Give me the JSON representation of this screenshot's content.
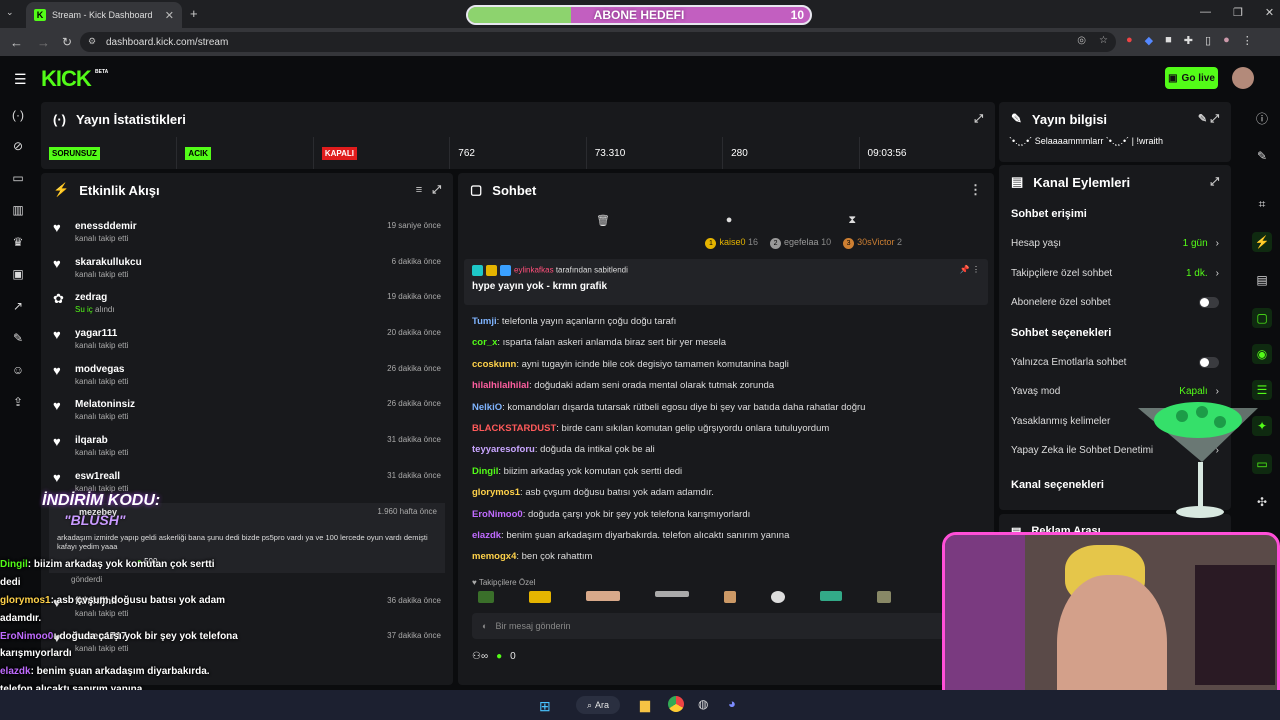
{
  "browser": {
    "tab_title": "Stream - Kick Dashboard",
    "url": "dashboard.kick.com/stream",
    "new_tab": "+"
  },
  "goal": {
    "label": "ABONE HEDEFI",
    "count": "10",
    "progress": 0.3
  },
  "header": {
    "logo": "KICK",
    "logo_sup": "BETA",
    "go_live": "Go live"
  },
  "stats": {
    "title": "Yayın İstatistikleri",
    "status1": "SORUNSUZ",
    "status2": "ACIK",
    "status3": "KAPALI",
    "viewers": "762",
    "followers": "73.310",
    "subs": "280",
    "duration": "09:03:56"
  },
  "activity": {
    "title": "Etkinlik Akışı",
    "events": [
      {
        "icon": "heart-icon",
        "name": "enessddemir",
        "sub": "kanalı takip etti",
        "time": "19 saniye önce"
      },
      {
        "icon": "heart-icon",
        "name": "skarakullukcu",
        "sub": "kanalı takip etti",
        "time": "6 dakika önce"
      },
      {
        "icon": "reward-icon",
        "name": "zedrag",
        "sub_highlight": "Su iç",
        "sub": "alındı",
        "time": "19 dakika önce"
      },
      {
        "icon": "heart-icon",
        "name": "yagar111",
        "sub": "kanalı takip etti",
        "time": "20 dakika önce"
      },
      {
        "icon": "heart-icon",
        "name": "modvegas",
        "sub": "kanalı takip etti",
        "time": "26 dakika önce"
      },
      {
        "icon": "heart-icon",
        "name": "Melatoninsiz",
        "sub": "kanalı takip etti",
        "time": "26 dakika önce"
      },
      {
        "icon": "heart-icon",
        "name": "ilqarab",
        "sub": "kanalı takip etti",
        "time": "31 dakika önce"
      },
      {
        "icon": "heart-icon",
        "name": "esw1reall",
        "sub": "kanalı takip etti",
        "time": "31 dakika önce"
      }
    ],
    "bigevent": {
      "name": "mezebey",
      "time": "1.960 hafta önce",
      "text": "arkadaşım izmirde yapıp geldi askerliği bana şunu dedi bizde ps5pro vardı ya ve 100 lercede oyun vardı demişti kafayı yedim yaaa",
      "amount": "500",
      "sent": "gönderdi"
    },
    "events_after": [
      {
        "name": "fkhjhfjhk",
        "sub": "kanalı takip etti",
        "time": "36 dakika önce"
      },
      {
        "name": "husen1717",
        "sub": "kanalı takip etti",
        "time": "37 dakika önce"
      }
    ],
    "promo": {
      "line1": "İNDİRİM KODU:",
      "line2": "\"BLUSH\""
    }
  },
  "chat": {
    "title": "Sohbet",
    "top": [
      {
        "name": "kaise0",
        "n": "16",
        "rank": "1"
      },
      {
        "name": "egefelaa",
        "n": "10",
        "rank": "2"
      },
      {
        "name": "30sVictor",
        "n": "2",
        "rank": "3"
      }
    ],
    "pinned_by": "eylinkafkas",
    "pinned_suffix": "tarafından sabitlendi",
    "pinned_text": "hype yayın yok - krmn grafik",
    "messages": [
      {
        "user": "Tumji",
        "color": "#7fb4ff",
        "text": "telefonla yayın açanların çoğu doğu tarafı"
      },
      {
        "user": "cor_x",
        "color": "#53fc18",
        "text": "ısparta falan askeri anlamda biraz sert bir yer mesela"
      },
      {
        "user": "ccoskunn",
        "color": "#ffd24a",
        "text": "ayni tugayin icinde bile cok degisiyo tamamen komutanina bagli"
      },
      {
        "user": "hilalhilalhilal",
        "color": "#ff5fa0",
        "text": "doğudaki adam seni orada mental olarak tutmak zorunda"
      },
      {
        "user": "NelkiO",
        "color": "#7fb4ff",
        "text": "komandoları dışarda tutarsak rütbeli egosu diye bi şey var batıda daha rahatlar doğru"
      },
      {
        "user": "BLACKSTARDUST",
        "color": "#ff5a5a",
        "text": "birde canı sıkılan komutan gelip uğrşıyordu onlara tutuluyordum"
      },
      {
        "user": "teyyaresoforu",
        "color": "#c9a6ff",
        "text": "doğuda da intikal çok be ali"
      },
      {
        "user": "Dingil",
        "color": "#53fc18",
        "text": "biizim arkadaş yok komutan çok sertti dedi"
      },
      {
        "user": "glorymos1",
        "color": "#ffd24a",
        "text": "asb çvşum doğusu batısı yok adam adamdır."
      },
      {
        "user": "EroNimoo0",
        "color": "#c06bff",
        "text": "doğuda çarşı yok bir şey yok telefona karışmıyorlardı"
      },
      {
        "user": "elazdk",
        "color": "#c06bff",
        "text": "benim şuan arkadaşım diyarbakırda. telefon alıcaktı sanırım yanına"
      },
      {
        "user": "memogx4",
        "color": "#ffd24a",
        "text": "ben çok rahattım"
      }
    ],
    "followers_only": "Takipçilere Özel",
    "placeholder": "Bir mesaj gönderin",
    "points": "0"
  },
  "info": {
    "title": "Yayın bilgisi",
    "stream_title": "`•.¸¸.•´ Selaaaammmlarr `•.¸¸.•´ | !wraith"
  },
  "actions": {
    "title": "Kanal Eylemleri",
    "chat_access": "Sohbet erişimi",
    "rows": [
      {
        "label": "Hesap yaşı",
        "value": "1 gün"
      },
      {
        "label": "Takipçilere özel sohbet",
        "value": "1 dk."
      },
      {
        "label": "Abonelere özel sohbet",
        "value": ""
      }
    ],
    "chat_options": "Sohbet seçenekleri",
    "rows2": [
      {
        "label": "Yalnızca Emotlarla sohbet",
        "value": ""
      },
      {
        "label": "Yavaş mod",
        "value": "Kapalı"
      },
      {
        "label": "Yasaklanmış kelimeler",
        "value": ""
      },
      {
        "label": "Yapay Zeka ile Sohbet Denetimi",
        "value": ""
      }
    ],
    "channel_options": "Kanal seçenekleri",
    "ad_break": "Reklam Arası"
  },
  "overlay_chat": [
    {
      "user": "Dingil",
      "color": "#53fc18",
      "text": ": biizim arkadaş yok komutan çok sertti"
    },
    {
      "user": "",
      "color": "#fff",
      "text": "dedi"
    },
    {
      "user": "glorymos1",
      "color": "#ffd24a",
      "text": ": asb çvşum doğusu batısı yok adam"
    },
    {
      "user": "",
      "color": "#fff",
      "text": "adamdır."
    },
    {
      "user": "EroNimoo0",
      "color": "#c06bff",
      "text": ": doğuda çarşı yok bir şey yok telefona"
    },
    {
      "user": "",
      "color": "#fff",
      "text": "karışmıyorlardı"
    },
    {
      "user": "elazdk",
      "color": "#c06bff",
      "text": ": benim şuan arkadaşım diyarbakırda."
    },
    {
      "user": "",
      "color": "#fff",
      "text": "telefon alıcaktı sanırım yanına"
    },
    {
      "user": "memogx4",
      "color": "#ffd24a",
      "text": ": ben çok rahattım"
    }
  ],
  "taskbar": {
    "search": "Ara"
  }
}
